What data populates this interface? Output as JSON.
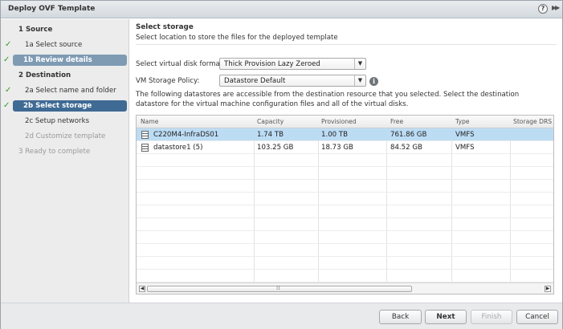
{
  "window": {
    "title": "Deploy OVF Template"
  },
  "sidebar": {
    "steps": [
      {
        "label": "1  Source"
      },
      {
        "label": "1a  Select source"
      },
      {
        "label": "1b  Review details"
      },
      {
        "label": "2  Destination"
      },
      {
        "label": "2a  Select name and folder"
      },
      {
        "label": "2b  Select storage"
      },
      {
        "label": "2c  Setup networks"
      },
      {
        "label": "2d  Customize template"
      },
      {
        "label": "3  Ready to complete"
      }
    ]
  },
  "main": {
    "heading": "Select storage",
    "subheading": "Select location to store the files for the deployed template",
    "disk_format_label": "Select virtual disk format:",
    "disk_format_value": "Thick Provision Lazy Zeroed",
    "policy_label": "VM Storage Policy:",
    "policy_value": "Datastore Default",
    "description": "The following datastores are accessible from the destination resource that you selected. Select the destination datastore for the virtual machine configuration files and all of the virtual disks.",
    "grid": {
      "columns": [
        "Name",
        "Capacity",
        "Provisioned",
        "Free",
        "Type",
        "Storage DRS"
      ],
      "rows": [
        [
          "C220M4-InfraDS01",
          "1.74 TB",
          "1.00 TB",
          "761.86 GB",
          "VMFS",
          ""
        ],
        [
          "datastore1 (5)",
          "103.25 GB",
          "18.73 GB",
          "84.52 GB",
          "VMFS",
          ""
        ]
      ]
    }
  },
  "footer": {
    "back": "Back",
    "next": "Next",
    "finish": "Finish",
    "cancel": "Cancel"
  },
  "colors": {
    "selected_step": "#3f6a94",
    "selected_row": "#bcdcf4",
    "check": "#3a9a2a"
  }
}
